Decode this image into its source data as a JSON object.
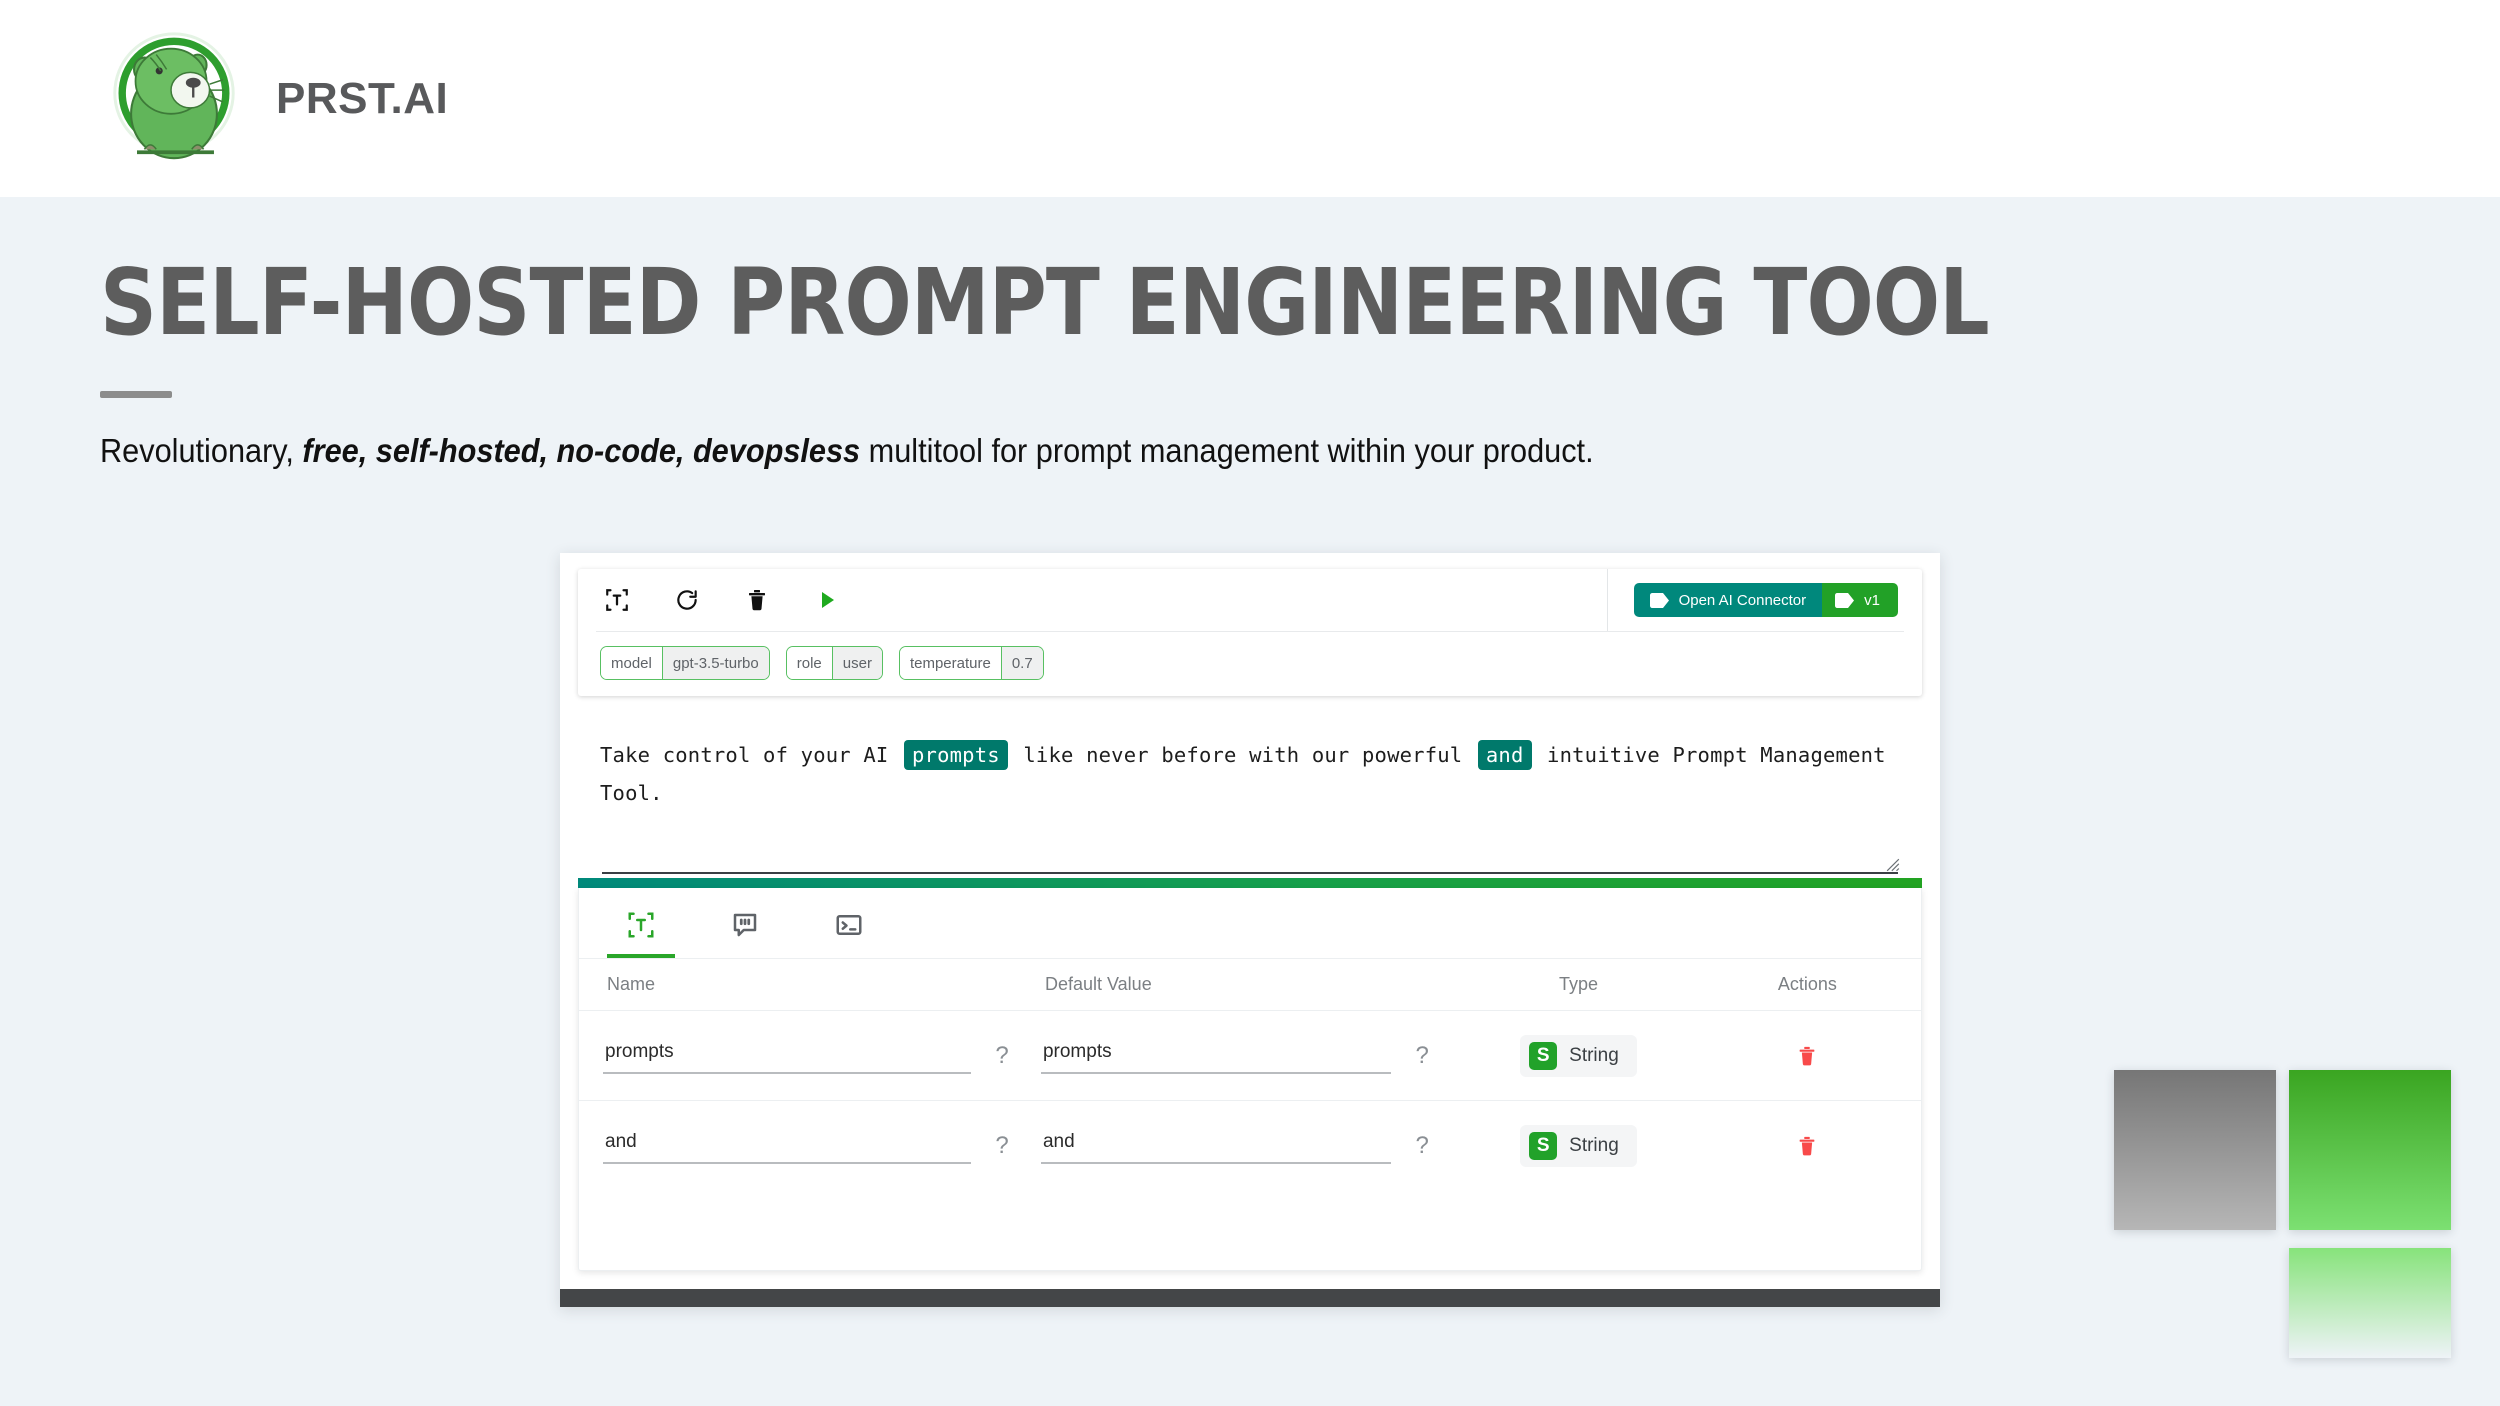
{
  "header": {
    "brand": "PRST.AI",
    "logo_icon": "capybara-logo-icon"
  },
  "hero": {
    "title": "SELF-HOSTED PROMPT ENGINEERING TOOL",
    "subtitle_lead": "Revolutionary, ",
    "subtitle_strong": "free, self-hosted, no-code, devopsless",
    "subtitle_tail": " multitool for prompt management within your product."
  },
  "app": {
    "toolbar": {
      "icons": [
        {
          "name": "variables-icon",
          "label": "Variables"
        },
        {
          "name": "refresh-icon",
          "label": "Refresh"
        },
        {
          "name": "trash-icon",
          "label": "Delete"
        },
        {
          "name": "run-play-icon",
          "label": "Run"
        }
      ],
      "badges": {
        "connector_label": "Open AI Connector",
        "version_label": "v1",
        "connector_color": "#00887c",
        "version_color": "#22a127"
      }
    },
    "params": [
      {
        "key": "model",
        "value": "gpt-3.5-turbo"
      },
      {
        "key": "role",
        "value": "user"
      },
      {
        "key": "temperature",
        "value": "0.7"
      }
    ],
    "prompt": {
      "part1": "Take control of your AI ",
      "var1": "prompts",
      "part2": " like never before with our powerful ",
      "var2": "and",
      "part3": " intuitive Prompt Management Tool."
    },
    "tabs": [
      {
        "name": "tab-variables",
        "icon": "variables-bracket-icon",
        "active": true
      },
      {
        "name": "tab-messages",
        "icon": "quote-bubble-icon",
        "active": false
      },
      {
        "name": "tab-console",
        "icon": "terminal-icon",
        "active": false
      }
    ],
    "table": {
      "columns": [
        "Name",
        "Default Value",
        "Type",
        "Actions"
      ],
      "help_glyph": "?",
      "rows": [
        {
          "name": "prompts",
          "default": "prompts",
          "type_initial": "S",
          "type_label": "String"
        },
        {
          "name": "and",
          "default": "and",
          "type_initial": "S",
          "type_label": "String"
        }
      ]
    }
  },
  "swatches": [
    {
      "name": "swatch-gray",
      "from": "#767676",
      "to": "#b6b6b6"
    },
    {
      "name": "swatch-green",
      "from": "#3aa521",
      "to": "#7ce072"
    },
    {
      "name": "swatch-green-fade",
      "from": "#87e37b",
      "to": "transparent"
    }
  ]
}
